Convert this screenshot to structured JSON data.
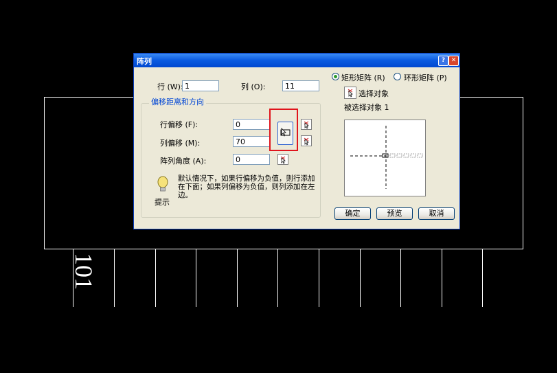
{
  "dialog": {
    "title": "阵列",
    "help_glyph": "?",
    "close_glyph": "✕",
    "rows_label": "行 (W):",
    "rows_value": "1",
    "cols_label": "列 (O):",
    "cols_value": "11",
    "offset_group_label": "偏移距离和方向",
    "row_offset_label": "行偏移 (F):",
    "row_offset_value": "0",
    "col_offset_label": "列偏移 (M):",
    "col_offset_value": "70",
    "angle_label": "阵列角度 (A):",
    "angle_value": "0",
    "tip_text": "默认情况下，如果行偏移为负值，则行添加在下面；如果列偏移为负值，则列添加在左边。",
    "tip_label": "提示",
    "rect_array_label": "矩形矩阵 (R)",
    "polar_array_label": "环形矩阵 (P)",
    "array_type_selected": "rect",
    "select_objects_label": "选择对象",
    "selected_count_label": "被选择对象 1",
    "ok_label": "确定",
    "preview_label": "预览",
    "cancel_label": "取消"
  },
  "canvas": {
    "text_label": "101"
  },
  "colors": {
    "titlebar": "#0a5ae0",
    "dialog_bg": "#ece9d8",
    "highlight": "#e0141c",
    "canvas_bg": "#000000",
    "line": "#ffffff"
  }
}
